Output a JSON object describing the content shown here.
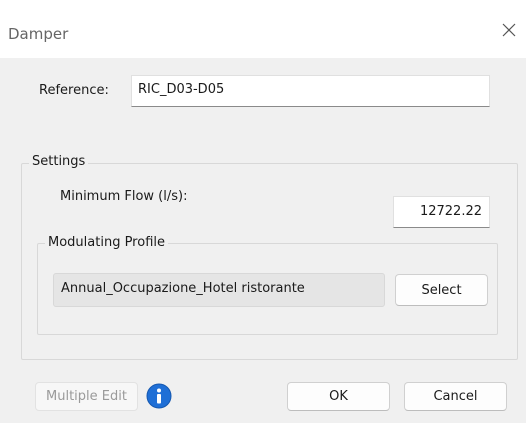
{
  "window": {
    "title": "Damper"
  },
  "reference": {
    "label": "Reference:",
    "value": "RIC_D03-D05"
  },
  "settings": {
    "group_title": "Settings",
    "min_flow_label": "Minimum Flow (l/s):",
    "min_flow_value": "12722.22",
    "modulating": {
      "group_title": "Modulating Profile",
      "profile_value": "Annual_Occupazione_Hotel ristorante",
      "select_label": "Select"
    }
  },
  "footer": {
    "multiple_edit_label": "Multiple Edit",
    "ok_label": "OK",
    "cancel_label": "Cancel"
  },
  "icons": {
    "close": "close-icon",
    "info": "info-icon"
  },
  "colors": {
    "info_blue": "#1f6fd6",
    "accent_border": "#8a8a8a"
  }
}
